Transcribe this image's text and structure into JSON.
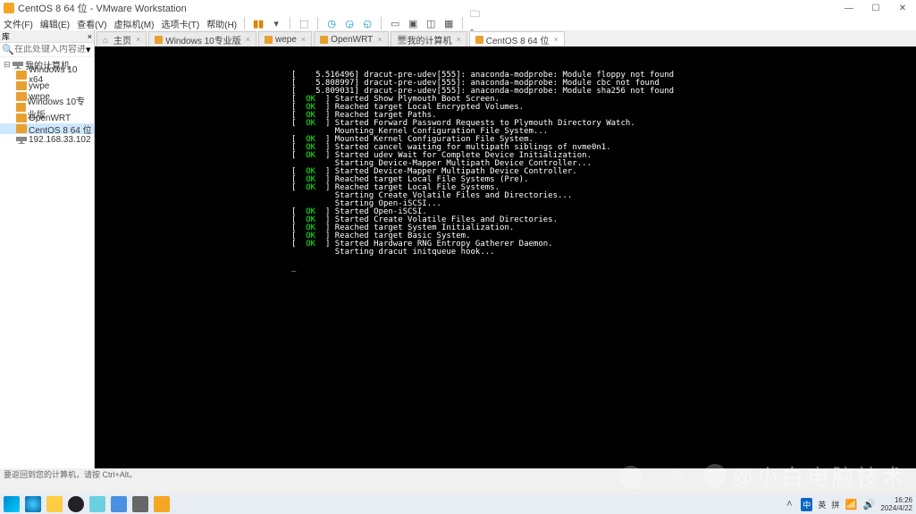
{
  "titlebar": {
    "title": "CentOS 8 64 位 - VMware Workstation"
  },
  "menu": {
    "file": "文件(F)",
    "edit": "编辑(E)",
    "view": "查看(V)",
    "vm": "虚拟机(M)",
    "tabs": "选项卡(T)",
    "help": "帮助(H)"
  },
  "sidebar": {
    "header": "库",
    "close": "×",
    "search_placeholder": "在此处键入内容进行搜索",
    "root": "我的计算机",
    "items": [
      "Windows 10 x64",
      "ywpe",
      "wepe",
      "Windows 10专业版",
      "OpenWRT",
      "CentOS 8 64 位",
      "192.168.33.102"
    ],
    "selected_index": 5
  },
  "tabs": [
    {
      "label": "主页",
      "kind": "home"
    },
    {
      "label": "Windows 10专业版",
      "kind": "vm"
    },
    {
      "label": "wepe",
      "kind": "vm"
    },
    {
      "label": "OpenWRT",
      "kind": "vm"
    },
    {
      "label": "我的计算机",
      "kind": "pc"
    },
    {
      "label": "CentOS 8 64 位",
      "kind": "vm",
      "active": true
    }
  ],
  "console_lines": [
    {
      "br": "[",
      "stat": "    5.516496",
      "msg": "] dracut-pre-udev[555]: anaconda-modprobe: Module floppy not found"
    },
    {
      "br": "[",
      "stat": "    5.808997",
      "msg": "] dracut-pre-udev[555]: anaconda-modprobe: Module cbc not found"
    },
    {
      "br": "[",
      "stat": "    5.809031",
      "msg": "] dracut-pre-udev[555]: anaconda-modprobe: Module sha256 not found"
    },
    {
      "br": "[",
      "ok": "  OK  ",
      "msg": "] Started Show Plymouth Boot Screen."
    },
    {
      "br": "[",
      "ok": "  OK  ",
      "msg": "] Reached target Local Encrypted Volumes."
    },
    {
      "br": "[",
      "ok": "  OK  ",
      "msg": "] Reached target Paths."
    },
    {
      "br": "[",
      "ok": "  OK  ",
      "msg": "] Started Forward Password Requests to Plymouth Directory Watch."
    },
    {
      "msg": "         Mounting Kernel Configuration File System..."
    },
    {
      "br": "[",
      "ok": "  OK  ",
      "msg": "] Mounted Kernel Configuration File System."
    },
    {
      "br": "[",
      "ok": "  OK  ",
      "msg": "] Started cancel waiting for multipath siblings of nvme0n1."
    },
    {
      "br": "[",
      "ok": "  OK  ",
      "msg": "] Started udev Wait for Complete Device Initialization."
    },
    {
      "msg": "         Starting Device-Mapper Multipath Device Controller..."
    },
    {
      "br": "[",
      "ok": "  OK  ",
      "msg": "] Started Device-Mapper Multipath Device Controller."
    },
    {
      "br": "[",
      "ok": "  OK  ",
      "msg": "] Reached target Local File Systems (Pre)."
    },
    {
      "br": "[",
      "ok": "  OK  ",
      "msg": "] Reached target Local File Systems."
    },
    {
      "msg": "         Starting Create Volatile Files and Directories..."
    },
    {
      "msg": "         Starting Open-iSCSI..."
    },
    {
      "br": "[",
      "ok": "  OK  ",
      "msg": "] Started Open-iSCSI."
    },
    {
      "br": "[",
      "ok": "  OK  ",
      "msg": "] Started Create Volatile Files and Directories."
    },
    {
      "br": "[",
      "ok": "  OK  ",
      "msg": "] Reached target System Initialization."
    },
    {
      "br": "[",
      "ok": "  OK  ",
      "msg": "] Reached target Basic System."
    },
    {
      "br": "[",
      "ok": "  OK  ",
      "msg": "] Started Hardware RNG Entropy Gatherer Daemon."
    },
    {
      "msg": "         Starting dracut initqueue hook..."
    }
  ],
  "statusbar": {
    "text": "要返回到您的计算机，请按 Ctrl+Alt。"
  },
  "systray": {
    "ime1": "中",
    "ime2": "英",
    "ime3": "拼",
    "time": "16:26",
    "date": "2024/4/22"
  },
  "watermark": {
    "pub": "公众号",
    "at": "@小白电脑技术"
  }
}
